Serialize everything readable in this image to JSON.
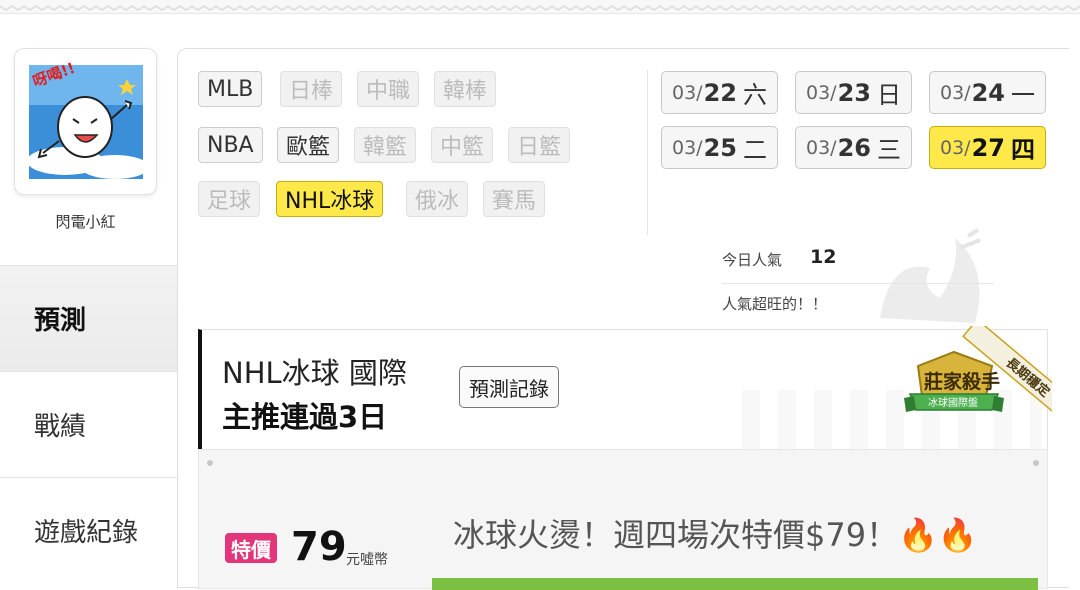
{
  "user": {
    "name": "閃電小紅"
  },
  "nav": {
    "items": [
      {
        "label": "預測",
        "active": true
      },
      {
        "label": "戰績",
        "active": false
      },
      {
        "label": "遊戲紀錄",
        "active": false
      }
    ]
  },
  "sports": {
    "row1": [
      {
        "label": "MLB",
        "state": "enabled"
      },
      {
        "label": "日棒",
        "state": "disabled"
      },
      {
        "label": "中職",
        "state": "disabled"
      },
      {
        "label": "韓棒",
        "state": "disabled"
      }
    ],
    "row2": [
      {
        "label": "NBA",
        "state": "enabled"
      },
      {
        "label": "歐籃",
        "state": "enabled"
      },
      {
        "label": "韓籃",
        "state": "disabled"
      },
      {
        "label": "中籃",
        "state": "disabled"
      },
      {
        "label": "日籃",
        "state": "disabled"
      }
    ],
    "row3": [
      {
        "label": "足球",
        "state": "disabled"
      },
      {
        "label": "NHL冰球",
        "state": "selected"
      },
      {
        "label": "俄冰",
        "state": "disabled"
      },
      {
        "label": "賽馬",
        "state": "disabled"
      }
    ]
  },
  "dates": [
    {
      "month": "03/",
      "day": "22",
      "weekday": "六",
      "selected": false
    },
    {
      "month": "03/",
      "day": "23",
      "weekday": "日",
      "selected": false
    },
    {
      "month": "03/",
      "day": "24",
      "weekday": "一",
      "selected": false
    },
    {
      "month": "03/",
      "day": "25",
      "weekday": "二",
      "selected": false
    },
    {
      "month": "03/",
      "day": "26",
      "weekday": "三",
      "selected": false
    },
    {
      "month": "03/",
      "day": "27",
      "weekday": "四",
      "selected": true
    }
  ],
  "popularity": {
    "label": "今日人氣",
    "value": "12",
    "message": "人氣超旺的！！"
  },
  "prediction": {
    "title": "NHL冰球 國際",
    "subtitle": "主推連過3日",
    "record_button": "預測記錄",
    "badge": {
      "title": "莊家殺手",
      "subtitle": "冰球國際盤",
      "ribbon": "長期穩定"
    }
  },
  "promo": {
    "tag": "特價",
    "price": "79",
    "currency": "元噓幣",
    "text": "冰球火燙！週四場次特價$79！🔥🔥"
  },
  "colors": {
    "selected_yellow": "#ffe84a",
    "special_pink": "#e2357a",
    "promo_bar_green": "#7bc043",
    "badge_gold": "#c9a21d",
    "badge_green": "#4caf50"
  },
  "avatar_art": {
    "text": "呀喝!!"
  }
}
